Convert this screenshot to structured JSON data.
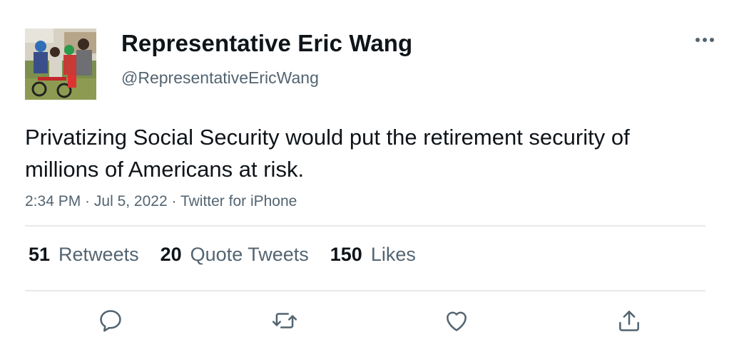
{
  "author": {
    "display_name": "Representative Eric Wang",
    "handle": "@RepresentativeEricWang",
    "avatar": "profile-photo"
  },
  "tweet": {
    "text": "Privatizing Social Security would put the retirement security of millions of Americans at risk.",
    "time": "2:34 PM",
    "separator_1": " · ",
    "date": "Jul 5, 2022",
    "separator_2": " · ",
    "source": "Twitter for iPhone"
  },
  "stats": {
    "retweets_count": "51",
    "retweets_label": "Retweets",
    "quotes_count": "20",
    "quotes_label": "Quote Tweets",
    "likes_count": "150",
    "likes_label": "Likes"
  },
  "actions": {
    "reply_icon": "reply-icon",
    "retweet_icon": "retweet-icon",
    "like_icon": "like-icon",
    "share_icon": "share-icon",
    "more_icon": "more-options-icon"
  },
  "colors": {
    "text_primary": "#0f1419",
    "text_secondary": "#536471",
    "divider": "#e6e9eb"
  }
}
